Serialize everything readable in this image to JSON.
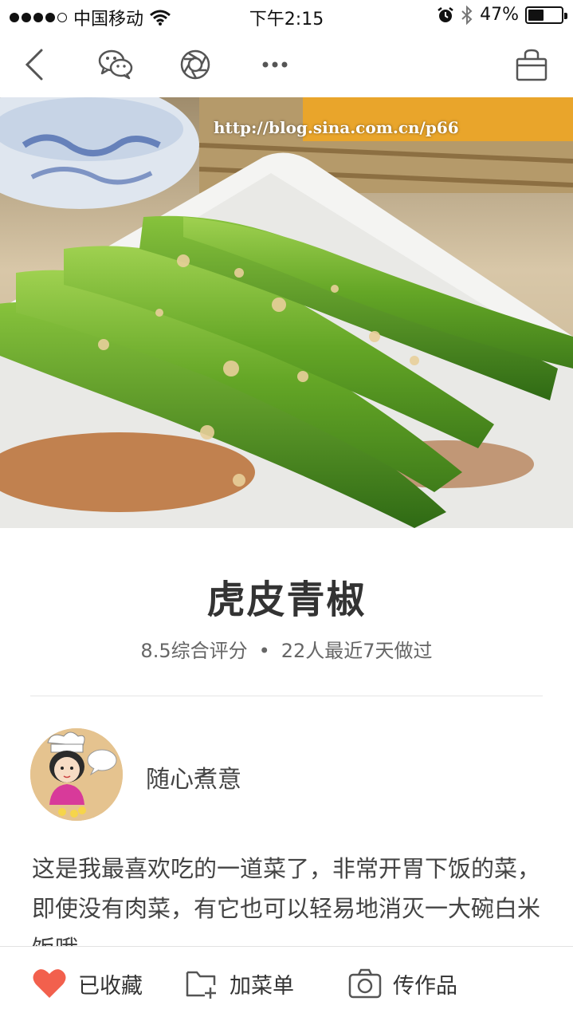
{
  "status_bar": {
    "carrier": "中国移动",
    "time": "下午2:15",
    "battery_percent": "47%",
    "battery_level": 0.47
  },
  "toolbar": {
    "back_icon": "chevron-left-icon",
    "wechat_icon": "wechat-icon",
    "moments_icon": "camera-shutter-icon",
    "more_icon": "more-dots-icon",
    "basket_icon": "basket-icon"
  },
  "hero": {
    "watermark": "http://blog.sina.com.cn/p66"
  },
  "recipe": {
    "title": "虎皮青椒",
    "rating": "8.5综合评分",
    "separator": "•",
    "cooked": "22人最近7天做过"
  },
  "author": {
    "name": "随心煮意"
  },
  "description": "这是我最喜欢吃的一道菜了，非常开胃下饭的菜，即使没有肉菜，有它也可以轻易地消灭一大碗白米饭哦",
  "bottom_bar": {
    "favorite_label": "已收藏",
    "add_menu_label": "加菜单",
    "upload_label": "传作品",
    "accent_color": "#f2604d"
  }
}
